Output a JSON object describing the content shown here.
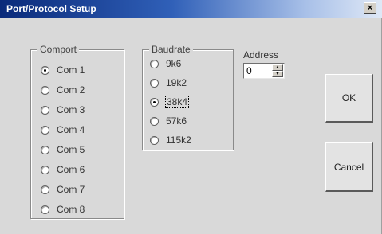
{
  "window": {
    "title": "Port/Protocol Setup",
    "close_glyph": "×"
  },
  "comport": {
    "legend": "Comport",
    "options": [
      "Com 1",
      "Com 2",
      "Com 3",
      "Com 4",
      "Com 5",
      "Com 6",
      "Com 7",
      "Com 8"
    ],
    "selected": "Com 1"
  },
  "baudrate": {
    "legend": "Baudrate",
    "options": [
      "9k6",
      "19k2",
      "38k4",
      "57k6",
      "115k2"
    ],
    "selected": "38k4"
  },
  "address": {
    "label": "Address",
    "value": "0"
  },
  "buttons": {
    "ok": "OK",
    "cancel": "Cancel"
  },
  "colors": {
    "titlebar_dark": "#0a2a7a",
    "titlebar_light": "#dfe8f6",
    "dialog_bg": "#d9d9d9"
  }
}
